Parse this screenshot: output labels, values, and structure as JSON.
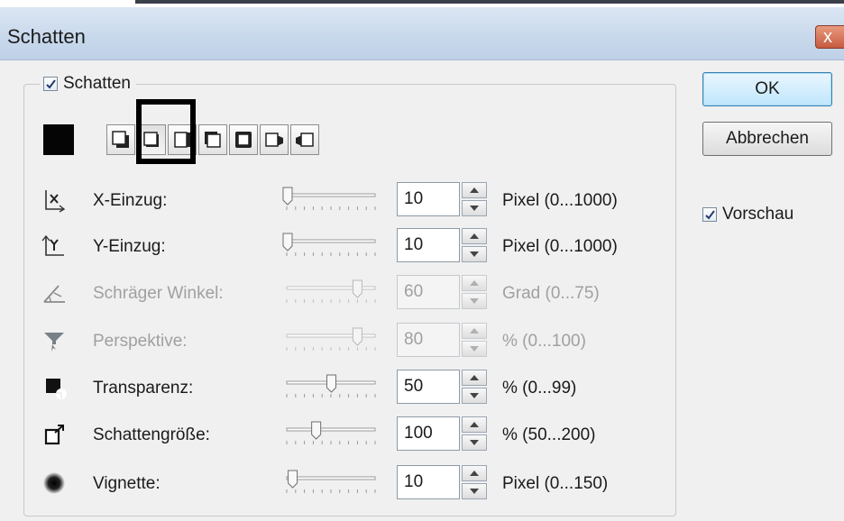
{
  "window": {
    "title": "Schatten",
    "close_glyph": "x"
  },
  "group": {
    "checkbox_label": "Schatten",
    "checked": true
  },
  "color_swatch": {
    "color": "#050505"
  },
  "shape_buttons": [
    {
      "icon": "shadow-bottom-right-icon",
      "selected": false
    },
    {
      "icon": "shadow-bottom-right-small-icon",
      "selected": true
    },
    {
      "icon": "shadow-right-icon",
      "selected": false
    },
    {
      "icon": "shadow-top-left-icon",
      "selected": false
    },
    {
      "icon": "shadow-all-around-icon",
      "selected": false
    },
    {
      "icon": "shadow-perspective-left-icon",
      "selected": false
    },
    {
      "icon": "shadow-perspective-right-icon",
      "selected": false
    }
  ],
  "params": [
    {
      "icon": "x-offset-icon",
      "label": "X-Einzug:",
      "value": "10",
      "unit": "Pixel (0...1000)",
      "enabled": true,
      "slider_fraction": 0.01
    },
    {
      "icon": "y-offset-icon",
      "label": "Y-Einzug:",
      "value": "10",
      "unit": "Pixel (0...1000)",
      "enabled": true,
      "slider_fraction": 0.01
    },
    {
      "icon": "angle-icon",
      "label": "Schräger Winkel:",
      "value": "60",
      "unit": "Grad (0...75)",
      "enabled": false,
      "slider_fraction": 0.8
    },
    {
      "icon": "perspective-funnel-icon",
      "label": "Perspektive:",
      "value": "80",
      "unit": "% (0...100)",
      "enabled": false,
      "slider_fraction": 0.8
    },
    {
      "icon": "transparency-icon",
      "label": "Transparenz:",
      "value": "50",
      "unit": "% (0...99)",
      "enabled": true,
      "slider_fraction": 0.505
    },
    {
      "icon": "shadow-size-icon",
      "label": "Schattengröße:",
      "value": "100",
      "unit": "% (50...200)",
      "enabled": true,
      "slider_fraction": 0.333
    },
    {
      "icon": "vignette-icon",
      "label": "Vignette:",
      "value": "10",
      "unit": "Pixel (0...150)",
      "enabled": true,
      "slider_fraction": 0.067
    }
  ],
  "buttons": {
    "ok": "OK",
    "cancel": "Abbrechen"
  },
  "preview": {
    "label": "Vorschau",
    "checked": true
  },
  "colors": {
    "accent": "#3c7fb1",
    "title_bar": "#c9d9ec",
    "dialog_bg": "#f0f0f0"
  }
}
